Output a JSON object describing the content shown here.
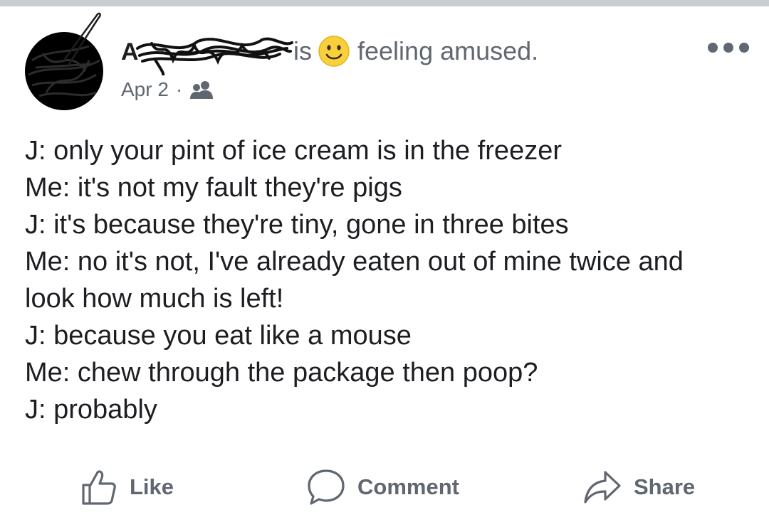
{
  "post": {
    "author": {
      "visible_initial": "A",
      "avatar_icon": "redacted-avatar",
      "name_icon": "redacted-name-scribble"
    },
    "status": {
      "verb": "is",
      "emoji_icon": "smiling-face-emoji",
      "feeling": "feeling amused."
    },
    "meta": {
      "date": "Apr 2",
      "separator": "·",
      "audience_icon": "friends-icon"
    },
    "more_icon": "more-options-icon",
    "body_lines": [
      "J: only your pint of ice cream is in the freezer",
      "Me: it's not my fault they're pigs",
      "J: it's because they're tiny, gone in three bites",
      "Me: no it's not, I've already eaten out of mine twice and",
      "look how much is left!",
      "J: because you eat like a mouse",
      "Me: chew through the package then poop?",
      "J: probably"
    ],
    "actions": {
      "like": {
        "label": "Like",
        "icon": "thumbs-up-icon"
      },
      "comment": {
        "label": "Comment",
        "icon": "speech-bubble-icon"
      },
      "share": {
        "label": "Share",
        "icon": "share-arrow-icon"
      }
    }
  },
  "colors": {
    "text": "#1c1e21",
    "secondary": "#606770",
    "divider": "#c9ccd1",
    "emoji_fill": "#f7d03c"
  }
}
